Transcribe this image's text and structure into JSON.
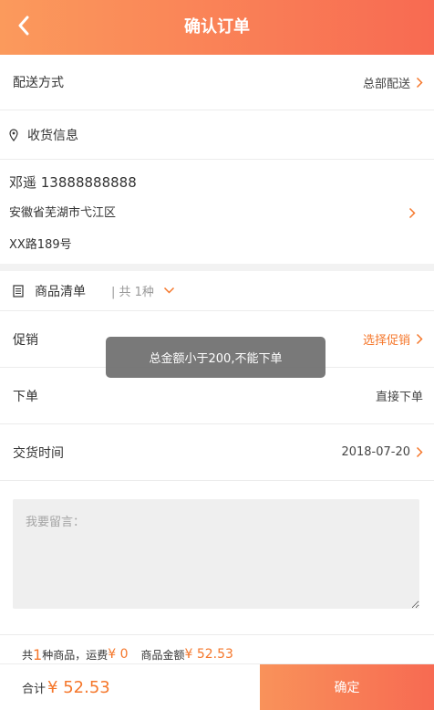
{
  "header": {
    "title": "确认订单",
    "back_icon": "chevron-left-icon"
  },
  "delivery": {
    "label": "配送方式",
    "value": "总部配送"
  },
  "address": {
    "section_label": "收货信息",
    "name_phone": "邓遥 13888888888",
    "line1": "安徽省芜湖市弋江区",
    "line2": "XX路189号"
  },
  "goods": {
    "label": "商品清单",
    "count": "| 共 1种"
  },
  "promotion": {
    "label": "促销",
    "value": "选择促销"
  },
  "order_type": {
    "label": "下单",
    "value": "直接下单"
  },
  "delivery_time": {
    "label": "交货时间",
    "value": "2018-07-20"
  },
  "remark": {
    "placeholder": "我要留言："
  },
  "summary": {
    "prefix": "共",
    "count": "1",
    "goods_suffix": "种商品，运费",
    "shipping": "¥ 0",
    "amount_label": "商品金额",
    "amount": "¥ 52.53"
  },
  "footer": {
    "total_label": "合计",
    "total_amount": "¥ 52.53",
    "confirm_label": "确定"
  },
  "toast": {
    "message": "总金额小于200,不能下单"
  },
  "colors": {
    "accent": "#f5772b",
    "header_start": "#fb9a5c",
    "header_end": "#f86a52"
  }
}
